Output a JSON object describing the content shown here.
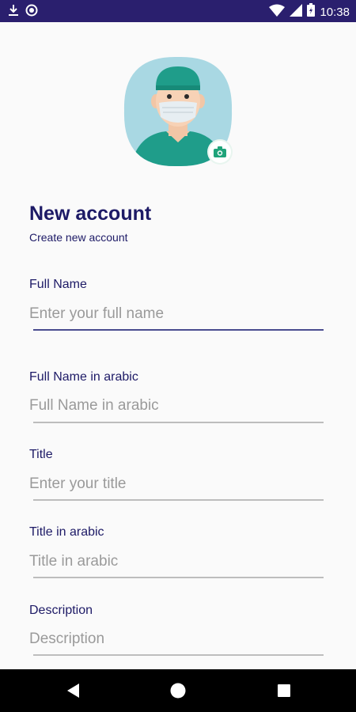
{
  "status_bar": {
    "time": "10:38",
    "icons_left": [
      "download-icon",
      "circle-sync-icon"
    ],
    "icons_right": [
      "wifi-icon",
      "signal-icon",
      "battery-icon"
    ]
  },
  "header": {
    "title": "New account",
    "subtitle": "Create new account"
  },
  "avatar": {
    "icon": "doctor-avatar",
    "camera_icon": "camera-icon"
  },
  "form": {
    "full_name": {
      "label": "Full Name",
      "placeholder": "Enter your full name",
      "value": ""
    },
    "full_name_ar": {
      "label": "Full Name in arabic",
      "placeholder": "Full Name in arabic",
      "value": ""
    },
    "title": {
      "label": "Title",
      "placeholder": "Enter your title",
      "value": ""
    },
    "title_ar": {
      "label": "Title in arabic",
      "placeholder": "Title in arabic",
      "value": ""
    },
    "description": {
      "label": "Description",
      "placeholder": "Description",
      "value": ""
    }
  },
  "nav_bar": {
    "buttons": [
      "back-icon",
      "home-icon",
      "recents-icon"
    ]
  },
  "colors": {
    "status_bar": "#2a1f6e",
    "primary_text": "#1d1a66",
    "accent_line": "#4a4c8f",
    "avatar_bg": "#a9d8e3",
    "scrub_green": "#1f9d8a",
    "camera_green": "#1fa37a"
  }
}
